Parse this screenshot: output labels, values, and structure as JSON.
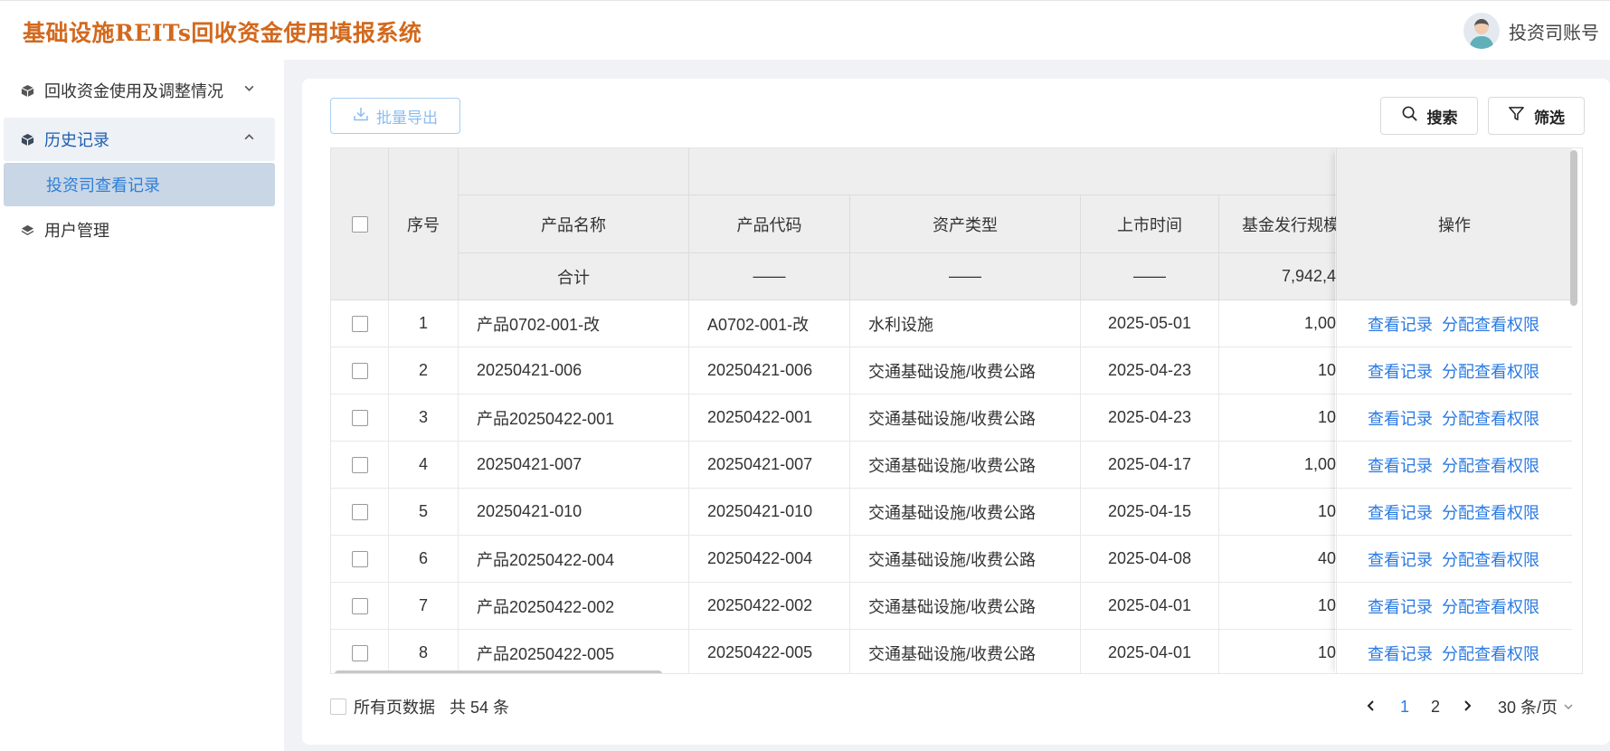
{
  "app": {
    "title": "基础设施REITs回收资金使用填报系统",
    "account": "投资司账号"
  },
  "sidebar": {
    "items": [
      {
        "label": "回收资金使用及调整情况"
      },
      {
        "label": "历史记录"
      },
      {
        "label": "投资司查看记录"
      },
      {
        "label": "用户管理"
      }
    ]
  },
  "toolbar": {
    "export_label": "批量导出",
    "search_label": "搜索",
    "filter_label": "筛选"
  },
  "table": {
    "headers": {
      "index": "序号",
      "name": "产品名称",
      "code": "产品代码",
      "asset_type": "资产类型",
      "list_date": "上市时间",
      "scale": "基金发行规模",
      "actions": "操作"
    },
    "totals": {
      "name": "合计",
      "code": "——",
      "asset_type": "——",
      "list_date": "——",
      "scale": "7,942,4"
    },
    "rows": [
      {
        "index": "1",
        "name": "产品0702-001-改",
        "code": "A0702-001-改",
        "asset_type": "水利设施",
        "list_date": "2025-05-01",
        "scale": "1,00"
      },
      {
        "index": "2",
        "name": "20250421-006",
        "code": "20250421-006",
        "asset_type": "交通基础设施/收费公路",
        "list_date": "2025-04-23",
        "scale": "10"
      },
      {
        "index": "3",
        "name": "产品20250422-001",
        "code": "20250422-001",
        "asset_type": "交通基础设施/收费公路",
        "list_date": "2025-04-23",
        "scale": "10"
      },
      {
        "index": "4",
        "name": "20250421-007",
        "code": "20250421-007",
        "asset_type": "交通基础设施/收费公路",
        "list_date": "2025-04-17",
        "scale": "1,00"
      },
      {
        "index": "5",
        "name": "20250421-010",
        "code": "20250421-010",
        "asset_type": "交通基础设施/收费公路",
        "list_date": "2025-04-15",
        "scale": "10"
      },
      {
        "index": "6",
        "name": "产品20250422-004",
        "code": "20250422-004",
        "asset_type": "交通基础设施/收费公路",
        "list_date": "2025-04-08",
        "scale": "40"
      },
      {
        "index": "7",
        "name": "产品20250422-002",
        "code": "20250422-002",
        "asset_type": "交通基础设施/收费公路",
        "list_date": "2025-04-01",
        "scale": "10"
      },
      {
        "index": "8",
        "name": "产品20250422-005",
        "code": "20250422-005",
        "asset_type": "交通基础设施/收费公路",
        "list_date": "2025-04-01",
        "scale": "10"
      }
    ],
    "action_view": "查看记录",
    "action_assign": "分配查看权限"
  },
  "footer": {
    "all_pages_label": "所有页数据",
    "total_label": "共 54 条",
    "pages": [
      "1",
      "2"
    ],
    "current_page": "1",
    "page_size": "30 条/页"
  }
}
